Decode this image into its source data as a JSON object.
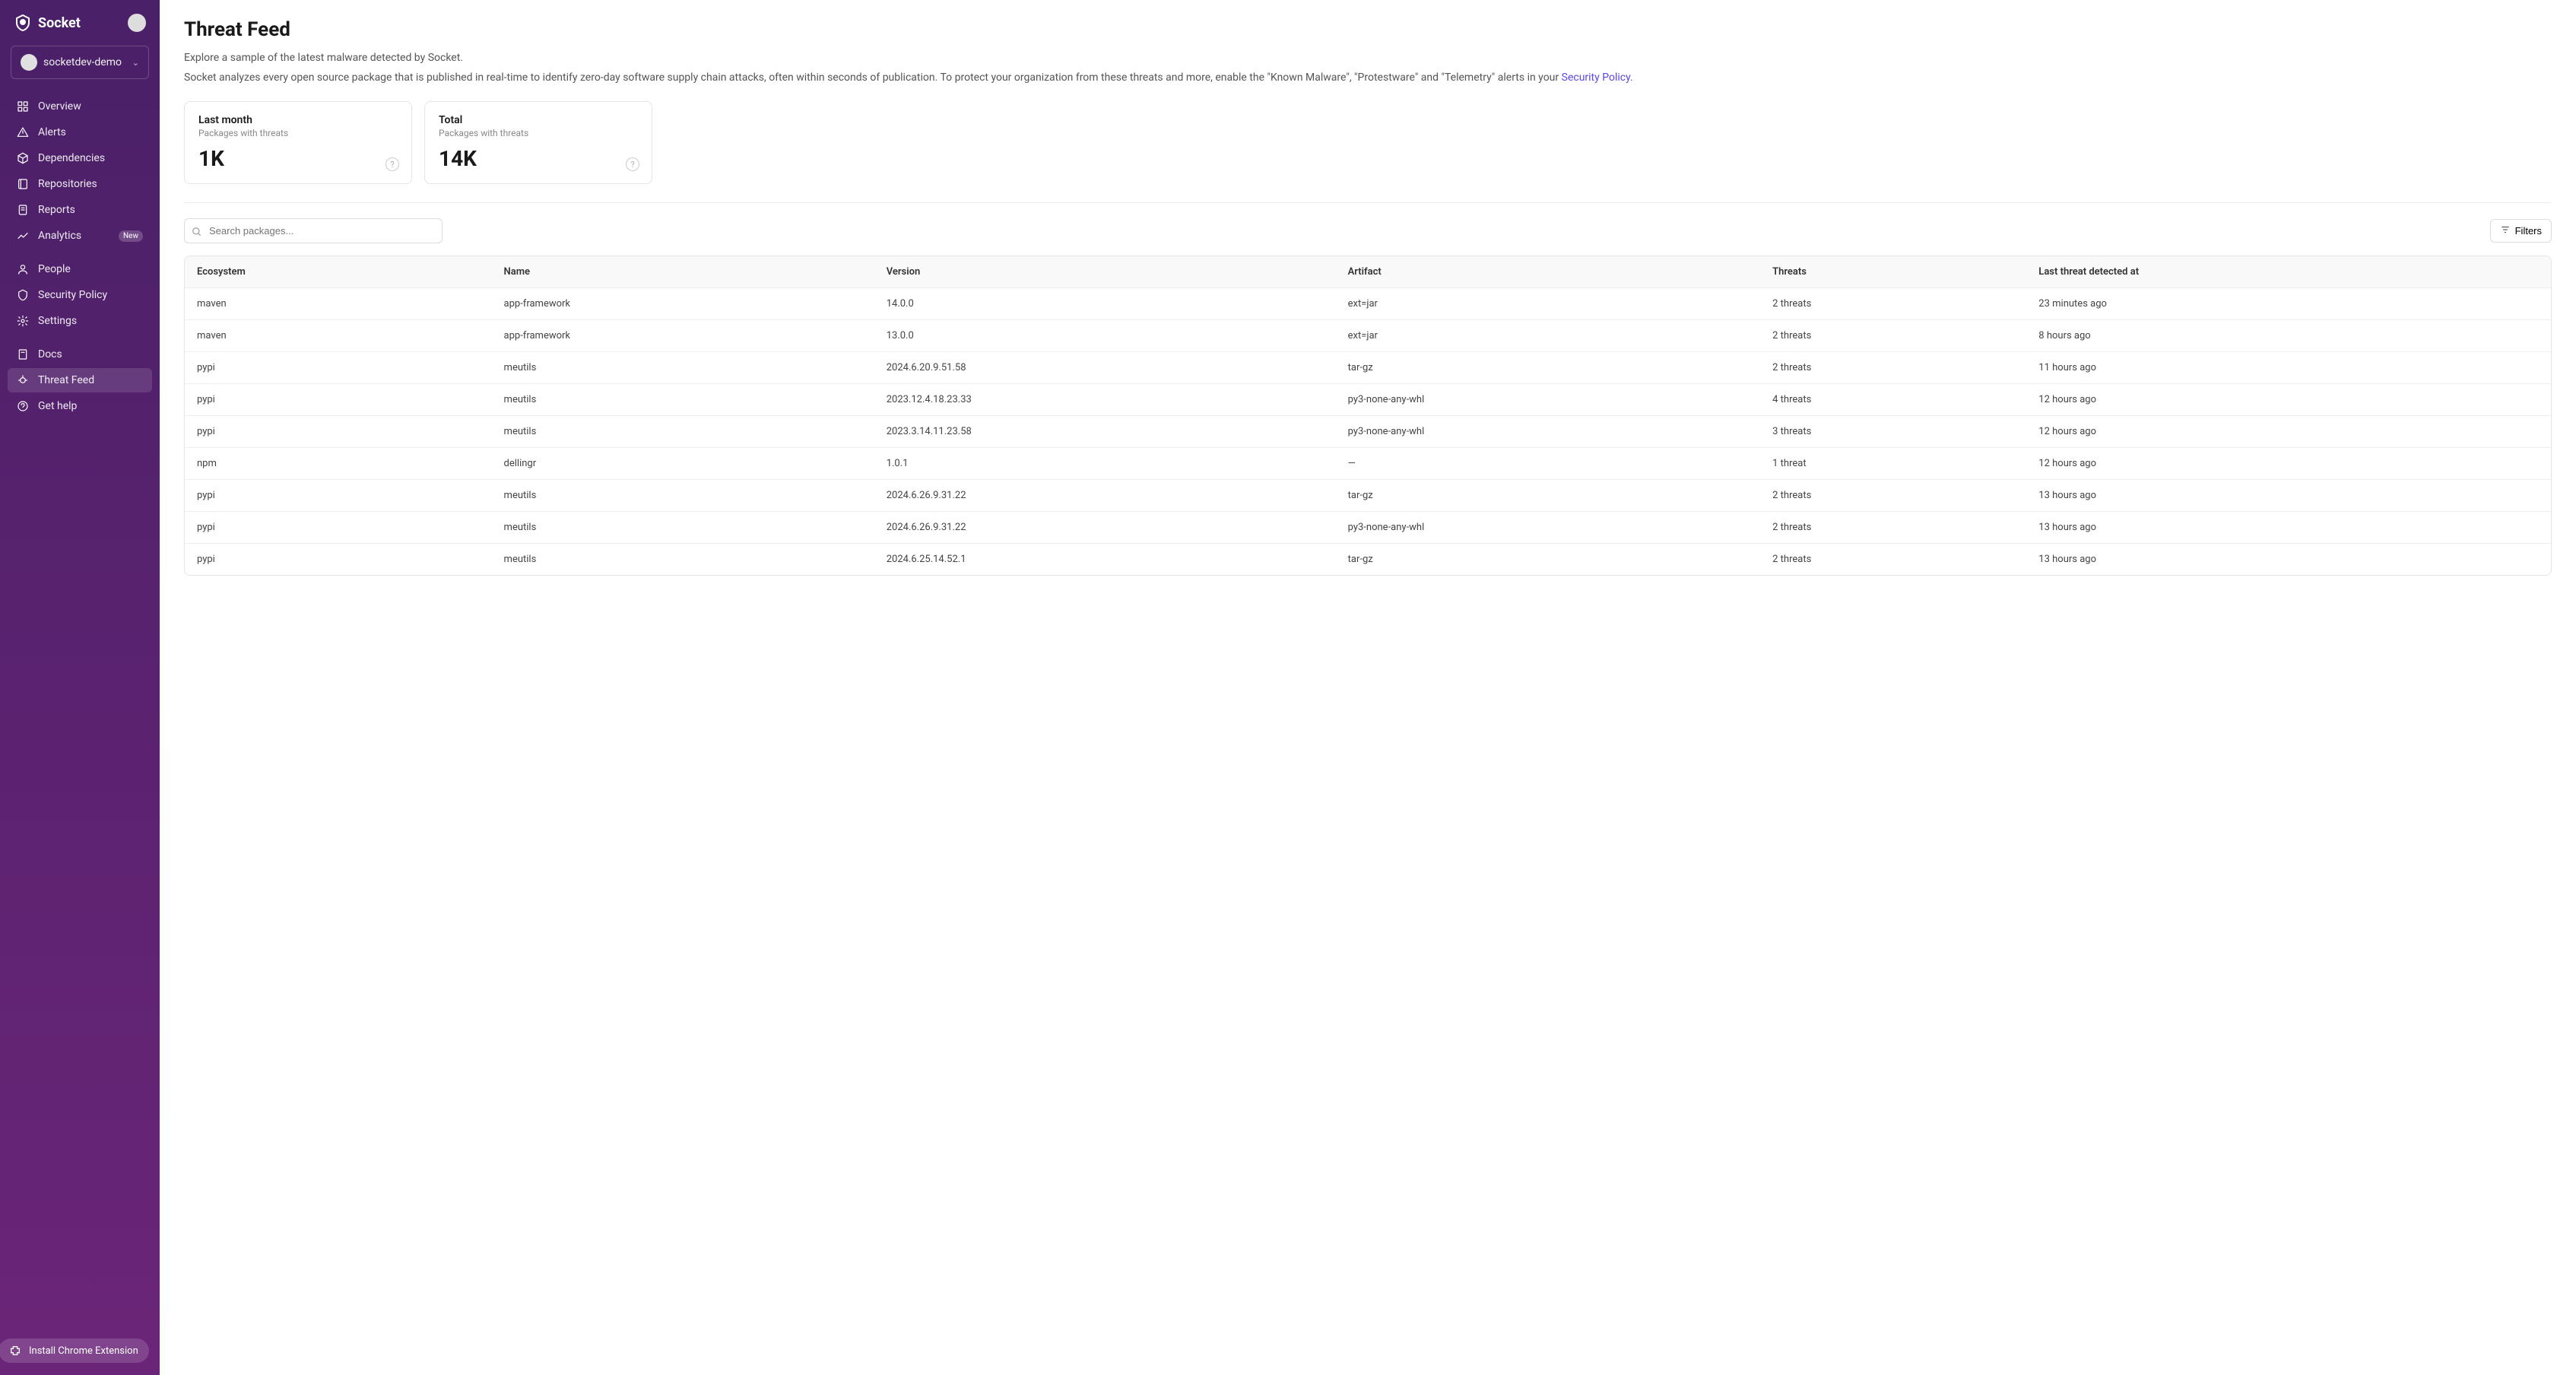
{
  "brand": "Socket",
  "org": {
    "name": "socketdev-demo"
  },
  "nav": {
    "items": [
      {
        "label": "Overview",
        "icon": "grid"
      },
      {
        "label": "Alerts",
        "icon": "alert"
      },
      {
        "label": "Dependencies",
        "icon": "package"
      },
      {
        "label": "Repositories",
        "icon": "repo"
      },
      {
        "label": "Reports",
        "icon": "report"
      },
      {
        "label": "Analytics",
        "icon": "analytics",
        "badge": "New"
      }
    ],
    "secondary": [
      {
        "label": "People",
        "icon": "people"
      },
      {
        "label": "Security Policy",
        "icon": "shield"
      },
      {
        "label": "Settings",
        "icon": "gear"
      }
    ],
    "tertiary": [
      {
        "label": "Docs",
        "icon": "docs"
      },
      {
        "label": "Threat Feed",
        "icon": "bug",
        "active": true
      },
      {
        "label": "Get help",
        "icon": "help"
      }
    ]
  },
  "install_label": "Install Chrome Extension",
  "page": {
    "title": "Threat Feed",
    "subtitle": "Explore a sample of the latest malware detected by Socket.",
    "desc_pre": "Socket analyzes every open source package that is published in real-time to identify zero-day software supply chain attacks, often within seconds of publication. To protect your organization from these threats and more, enable the \"Known Malware\", \"Protestware\" and \"Telemetry\" alerts in your ",
    "desc_link": "Security Policy",
    "desc_post": "."
  },
  "stats": [
    {
      "label": "Last month",
      "sub": "Packages with threats",
      "value": "1K"
    },
    {
      "label": "Total",
      "sub": "Packages with threats",
      "value": "14K"
    }
  ],
  "search": {
    "placeholder": "Search packages..."
  },
  "filters_label": "Filters",
  "table": {
    "columns": [
      "Ecosystem",
      "Name",
      "Version",
      "Artifact",
      "Threats",
      "Last threat detected at"
    ],
    "rows": [
      {
        "ecosystem": "maven",
        "name": "app-framework",
        "version": "14.0.0",
        "artifact": "ext=jar",
        "threats": "2 threats",
        "detected": "23 minutes ago"
      },
      {
        "ecosystem": "maven",
        "name": "app-framework",
        "version": "13.0.0",
        "artifact": "ext=jar",
        "threats": "2 threats",
        "detected": "8 hours ago"
      },
      {
        "ecosystem": "pypi",
        "name": "meutils",
        "version": "2024.6.20.9.51.58",
        "artifact": "tar-gz",
        "threats": "2 threats",
        "detected": "11 hours ago"
      },
      {
        "ecosystem": "pypi",
        "name": "meutils",
        "version": "2023.12.4.18.23.33",
        "artifact": "py3-none-any-whl",
        "threats": "4 threats",
        "detected": "12 hours ago"
      },
      {
        "ecosystem": "pypi",
        "name": "meutils",
        "version": "2023.3.14.11.23.58",
        "artifact": "py3-none-any-whl",
        "threats": "3 threats",
        "detected": "12 hours ago"
      },
      {
        "ecosystem": "npm",
        "name": "dellingr",
        "version": "1.0.1",
        "artifact": "—",
        "threats": "1 threat",
        "detected": "12 hours ago"
      },
      {
        "ecosystem": "pypi",
        "name": "meutils",
        "version": "2024.6.26.9.31.22",
        "artifact": "tar-gz",
        "threats": "2 threats",
        "detected": "13 hours ago"
      },
      {
        "ecosystem": "pypi",
        "name": "meutils",
        "version": "2024.6.26.9.31.22",
        "artifact": "py3-none-any-whl",
        "threats": "2 threats",
        "detected": "13 hours ago"
      },
      {
        "ecosystem": "pypi",
        "name": "meutils",
        "version": "2024.6.25.14.52.1",
        "artifact": "tar-gz",
        "threats": "2 threats",
        "detected": "13 hours ago"
      }
    ]
  }
}
